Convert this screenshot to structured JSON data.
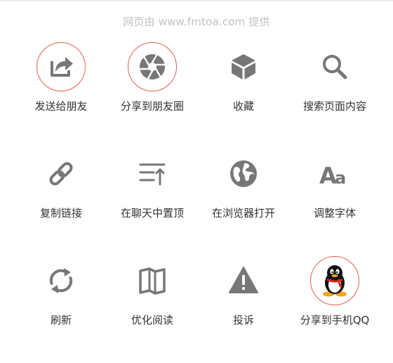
{
  "provider_text": "网页由 www.fmtoa.com 提供",
  "colors": {
    "icon_gray": "#777777",
    "ring_red": "#e2614f",
    "label": "#333333",
    "provider": "#c2c2c2"
  },
  "actions": [
    {
      "name": "share-to-friend",
      "icon": "share-icon",
      "label": "发送给朋友"
    },
    {
      "name": "share-to-moments",
      "icon": "moments-icon",
      "label": "分享到朋友圈"
    },
    {
      "name": "favorite",
      "icon": "cube-icon",
      "label": "收藏"
    },
    {
      "name": "search-page",
      "icon": "search-icon",
      "label": "搜索页面内容"
    },
    {
      "name": "copy-link",
      "icon": "link-icon",
      "label": "复制链接"
    },
    {
      "name": "pin-to-chat",
      "icon": "pin-top-icon",
      "label": "在聊天中置顶"
    },
    {
      "name": "open-in-browser",
      "icon": "globe-icon",
      "label": "在浏览器打开"
    },
    {
      "name": "font-size",
      "icon": "font-icon",
      "label": "调整字体"
    },
    {
      "name": "refresh",
      "icon": "refresh-icon",
      "label": "刷新"
    },
    {
      "name": "reading-mode",
      "icon": "book-icon",
      "label": "优化阅读"
    },
    {
      "name": "report",
      "icon": "warning-icon",
      "label": "投诉"
    },
    {
      "name": "share-to-qq",
      "icon": "qq-penguin-icon",
      "label": "分享到手机QQ"
    }
  ]
}
